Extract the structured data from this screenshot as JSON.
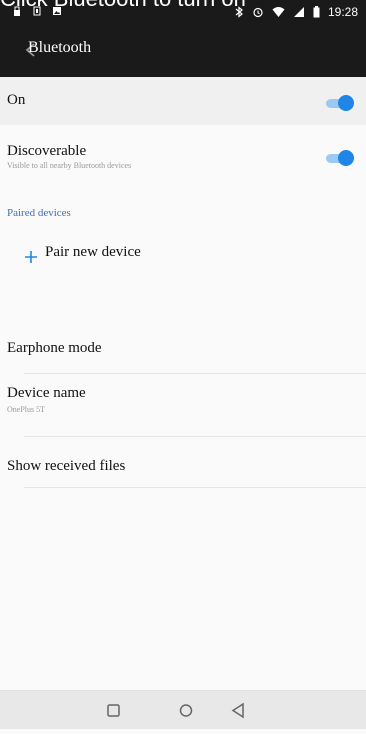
{
  "instruction": "Click Bluetooth to turn on",
  "status_bar": {
    "time": "19:28",
    "left_icons": [
      "lock-icon",
      "sim-icon",
      "image-icon"
    ],
    "right_icons": [
      "bluetooth-icon",
      "alarm-icon",
      "wifi-icon",
      "signal-icon",
      "battery-icon"
    ]
  },
  "app_bar": {
    "title": "Bluetooth",
    "back_icon": "back-arrow-icon"
  },
  "settings": {
    "on": {
      "label": "On",
      "enabled": true
    },
    "discoverable": {
      "label": "Discoverable",
      "subtitle": "Visible to all nearby Bluetooth devices",
      "enabled": true
    },
    "paired_header": "Paired devices",
    "pair_new_device": "Pair new device",
    "earphone_mode": "Earphone mode",
    "device_name": {
      "label": "Device name",
      "value": "OnePlus 5T"
    },
    "show_received_files": "Show received files"
  },
  "nav_bar": {
    "buttons": [
      "recent-apps-icon",
      "home-icon",
      "back-icon"
    ]
  },
  "colors": {
    "status_bar": "#1a1a1a",
    "accent": "#1f86e8",
    "accent_track": "#9cc9f3",
    "divider": "#e6e6e6",
    "section_header": "#3f6fb3"
  }
}
